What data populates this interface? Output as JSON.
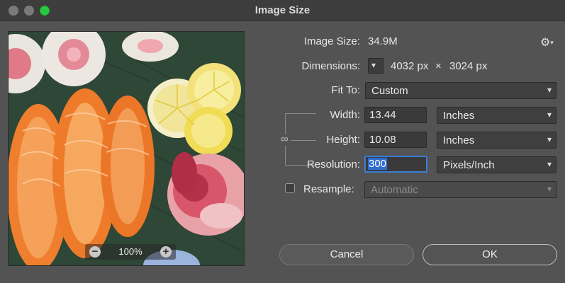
{
  "window": {
    "title": "Image Size"
  },
  "preview": {
    "zoom_level": "100%",
    "zoom_out_symbol": "−",
    "zoom_in_symbol": "+"
  },
  "image_size": {
    "label": "Image Size:",
    "value": "34.9M"
  },
  "dimensions": {
    "label": "Dimensions:",
    "width": "4032 px",
    "separator": "×",
    "height": "3024 px"
  },
  "fit_to": {
    "label": "Fit To:",
    "value": "Custom"
  },
  "width": {
    "label": "Width:",
    "value": "13.44",
    "unit": "Inches"
  },
  "height": {
    "label": "Height:",
    "value": "10.08",
    "unit": "Inches"
  },
  "resolution": {
    "label": "Resolution:",
    "value": "300",
    "unit": "Pixels/Inch"
  },
  "resample": {
    "label": "Resample:",
    "checked": false,
    "value": "Automatic"
  },
  "buttons": {
    "cancel": "Cancel",
    "ok": "OK"
  },
  "colors": {
    "window_bg": "#535353",
    "focus": "#3a7cd8",
    "maximize": "#27c93f"
  },
  "icons": {
    "settings": "gear-icon",
    "link": "chain-link-icon",
    "dropdown": "chevron-down-icon"
  }
}
